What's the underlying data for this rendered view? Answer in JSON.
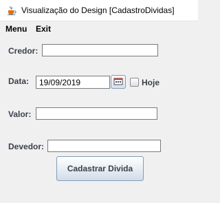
{
  "window": {
    "title": "Visualização do Design [CadastroDividas]",
    "icon": "java-cup-icon"
  },
  "menu": {
    "items": [
      "Menu",
      "Exit"
    ]
  },
  "form": {
    "credor": {
      "label": "Credor:",
      "value": ""
    },
    "data": {
      "label": "Data:",
      "value": "19/09/2019",
      "calendar_icon": "calendar-icon"
    },
    "hoje": {
      "label": "Hoje",
      "checked": false
    },
    "valor": {
      "label": "Valor:",
      "value": ""
    },
    "devedor": {
      "label": "Devedor:",
      "value": ""
    },
    "submit_label": "Cadastrar Divida"
  }
}
